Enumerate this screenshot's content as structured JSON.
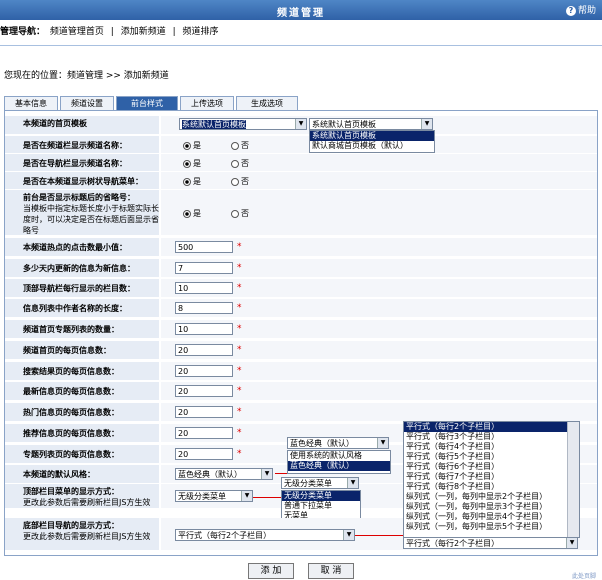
{
  "window": {
    "title": "频道管理",
    "help_label": "帮助"
  },
  "nav": {
    "label": "管理导航：",
    "items": [
      "频道管理首页",
      "添加新频道",
      "频道排序"
    ],
    "separator": "|"
  },
  "location": "您现在的位置：频道管理 >> 添加新频道",
  "tabs": [
    "基本信息",
    "频道设置",
    "前台样式",
    "上传选项",
    "生成选项"
  ],
  "active_tab": "前台样式",
  "form": {
    "homepage_template": {
      "label": "本频道的首页模板",
      "value": "系统默认首页模板",
      "value2": "系统默认首页模板",
      "options": [
        "系统默认首页模板",
        "默认商城首页模板（默认）"
      ]
    },
    "show_name_nav": {
      "label": "是否在频道栏显示频道名称：",
      "yes": "是",
      "no": "否"
    },
    "show_name_nav2": {
      "label": "是否在导航栏显示频道名称：",
      "yes": "是",
      "no": "否"
    },
    "show_tree_nav": {
      "label": "是否在本频道显示树状导航菜单：",
      "yes": "是",
      "no": "否"
    },
    "show_title_omit": {
      "label": "前台是否显示标题后的省略号：",
      "hint": "当模板中指定标题长度小于标题实际长度时，可以决定是否在标题后面显示省略号",
      "yes": "是",
      "no": "否"
    },
    "hot_threshold": {
      "label": "本频道热点的点击数最小值：",
      "value": "500"
    },
    "new_days": {
      "label": "多少天内更新的信息为新信息：",
      "value": "7"
    },
    "top_nav_per_row": {
      "label": "顶部导航栏每行显示的栏目数：",
      "value": "10"
    },
    "author_len": {
      "label": "信息列表中作者名称的长度：",
      "value": "8"
    },
    "special_count": {
      "label": "频道首页专题列表的数量：",
      "value": "10"
    },
    "home_per_page": {
      "label": "频道首页的每页信息数：",
      "value": "20"
    },
    "search_per_page": {
      "label": "搜索结果页的每页信息数：",
      "value": "20"
    },
    "latest_per_page": {
      "label": "最新信息页的每页信息数：",
      "value": "20"
    },
    "hot_per_page": {
      "label": "热门信息页的每页信息数：",
      "value": "20"
    },
    "recommend_per_page": {
      "label": "推荐信息页的每页信息数：",
      "value": "20"
    },
    "special_per_page": {
      "label": "专题列表页的每页信息数：",
      "value": "20"
    },
    "default_style": {
      "label": "本频道的默认风格：",
      "value": "蓝色经典（默认）",
      "popup_value": "蓝色经典（默认）",
      "options": [
        "使用系统的默认风格",
        "蓝色经典（默认）"
      ]
    },
    "top_menu_style": {
      "label": "顶部栏目菜单的显示方式：",
      "hint": "更改此参数后需要刷新栏目JS方生效",
      "value": "无级分类菜单",
      "popup_value": "无级分类菜单",
      "options": [
        "无级分类菜单",
        "普通下拉菜单",
        "无菜单"
      ]
    },
    "bottom_nav_style": {
      "label": "底部栏目导航的显示方式：",
      "hint": "更改此参数后需要刷新栏目JS方生效",
      "value": "平行式（每行2个子栏目）",
      "list_value": "平行式（每行2个子栏目）",
      "options": [
        "平行式（每行2个子栏目）",
        "平行式（每行3个子栏目）",
        "平行式（每行4个子栏目）",
        "平行式（每行5个子栏目）",
        "平行式（每行6个子栏目）",
        "平行式（每行7个子栏目）",
        "平行式（每行8个子栏目）",
        "纵列式（一列，每列中显示2个子栏目）",
        "纵列式（一列，每列中显示3个子栏目）",
        "纵列式（一列，每列中显示4个子栏目）",
        "纵列式（一列，每列中显示5个子栏目）"
      ]
    }
  },
  "buttons": {
    "add": "添 加",
    "cancel": "取 消"
  },
  "footer": "此处页脚",
  "colors": {
    "title_bg": "#2f61a7",
    "label_bg": "#e6ecf5",
    "required": "#dd0000"
  }
}
